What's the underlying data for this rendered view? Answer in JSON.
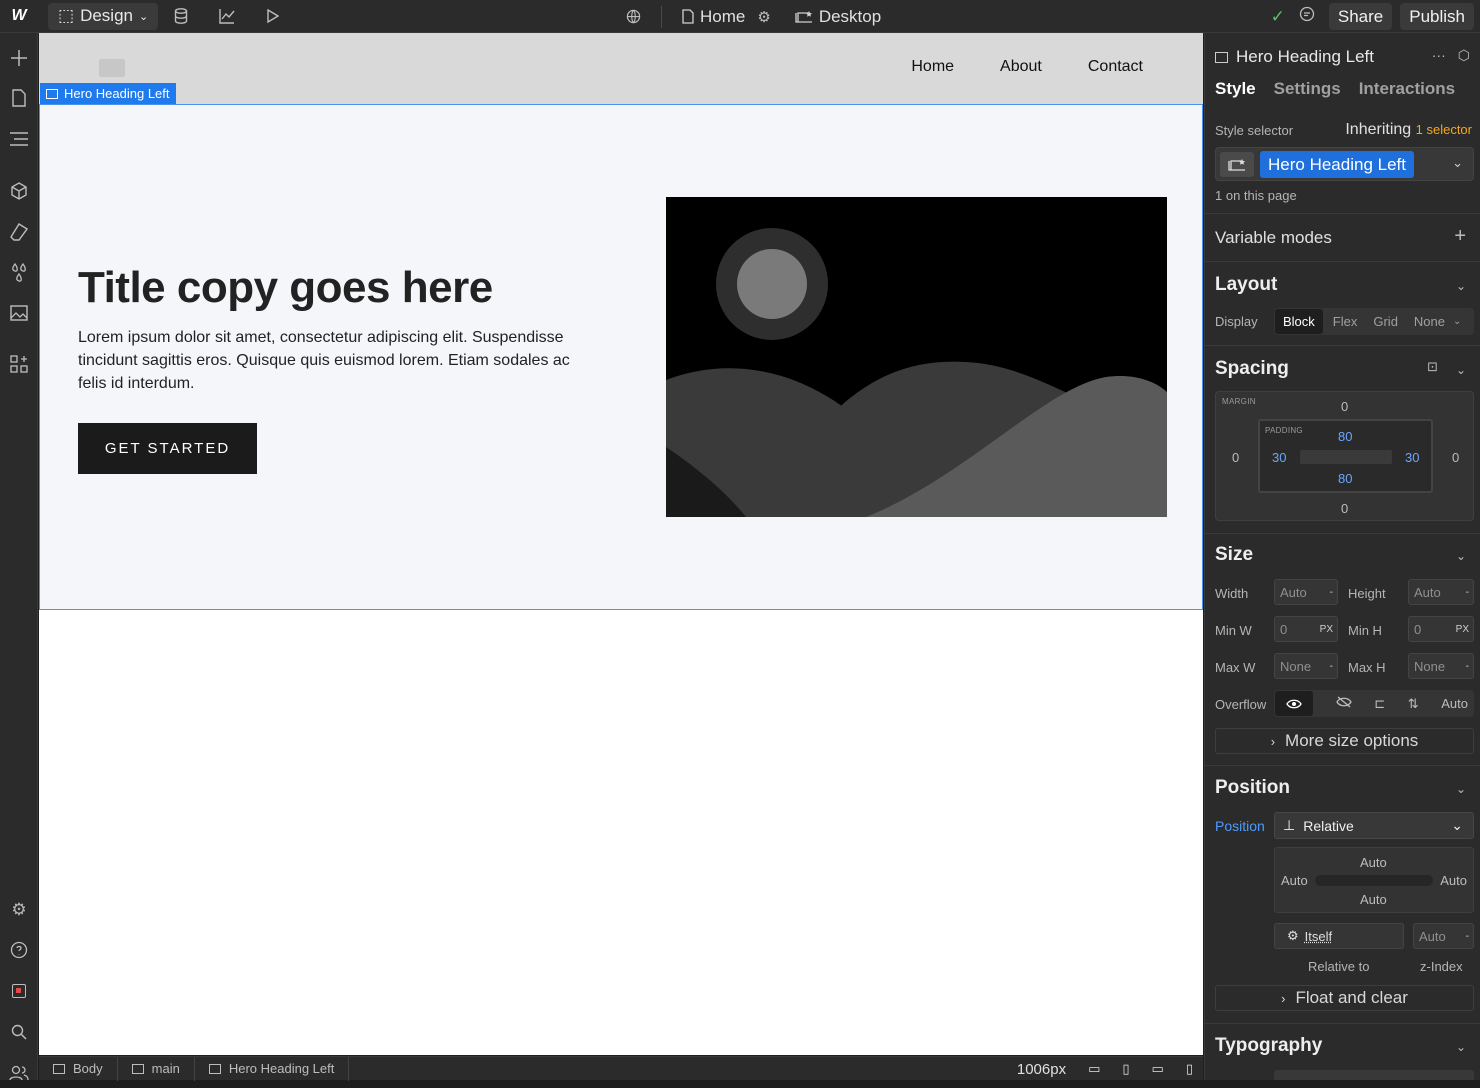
{
  "topbar": {
    "logo": "W",
    "design_label": "Design",
    "page_label": "Home",
    "breakpoint_label": "Desktop",
    "share_label": "Share",
    "publish_label": "Publish"
  },
  "canvas": {
    "nav": {
      "links": [
        "Home",
        "About",
        "Contact"
      ]
    },
    "selected_tag": "Hero Heading Left",
    "hero": {
      "title": "Title copy goes here",
      "body": "Lorem ipsum dolor sit amet, consectetur adipiscing elit. Suspendisse tincidunt sagittis eros. Quisque quis euismod lorem. Etiam sodales ac felis id interdum.",
      "button_label": "GET STARTED"
    }
  },
  "bottombar": {
    "crumbs": [
      "Body",
      "main",
      "Hero Heading Left"
    ],
    "width_label": "1006px"
  },
  "panel": {
    "element_name": "Hero Heading Left",
    "tabs": [
      "Style",
      "Settings",
      "Interactions"
    ],
    "style_selector_label": "Style selector",
    "inheriting_label": "Inheriting",
    "inheriting_count": "1 selector",
    "selector_name": "Hero Heading Left",
    "on_page_label": "1 on this page",
    "variable_modes_label": "Variable modes",
    "layout": {
      "title": "Layout",
      "display_label": "Display",
      "display_options": [
        "Block",
        "Flex",
        "Grid",
        "None"
      ]
    },
    "spacing": {
      "title": "Spacing",
      "margin_label": "MARGIN",
      "padding_label": "PADDING",
      "margin_top": "0",
      "margin_right": "0",
      "margin_bottom": "0",
      "margin_left": "0",
      "padding_top": "80",
      "padding_right": "30",
      "padding_bottom": "80",
      "padding_left": "30"
    },
    "size": {
      "title": "Size",
      "width_label": "Width",
      "width_value": "Auto",
      "height_label": "Height",
      "height_value": "Auto",
      "minw_label": "Min W",
      "minw_value": "0",
      "minw_unit": "PX",
      "minh_label": "Min H",
      "minh_value": "0",
      "minh_unit": "PX",
      "maxw_label": "Max W",
      "maxw_value": "None",
      "maxh_label": "Max H",
      "maxh_value": "None",
      "overflow_label": "Overflow",
      "overflow_auto": "Auto",
      "more_label": "More size options"
    },
    "position": {
      "title": "Position",
      "label": "Position",
      "value": "Relative",
      "top": "Auto",
      "left": "Auto",
      "right": "Auto",
      "bottom": "Auto",
      "relative_to_value": "Itself",
      "zindex_value": "Auto",
      "relative_to_label": "Relative to",
      "zindex_label": "z-Index",
      "float_label": "Float and clear"
    },
    "typography": {
      "title": "Typography"
    }
  }
}
